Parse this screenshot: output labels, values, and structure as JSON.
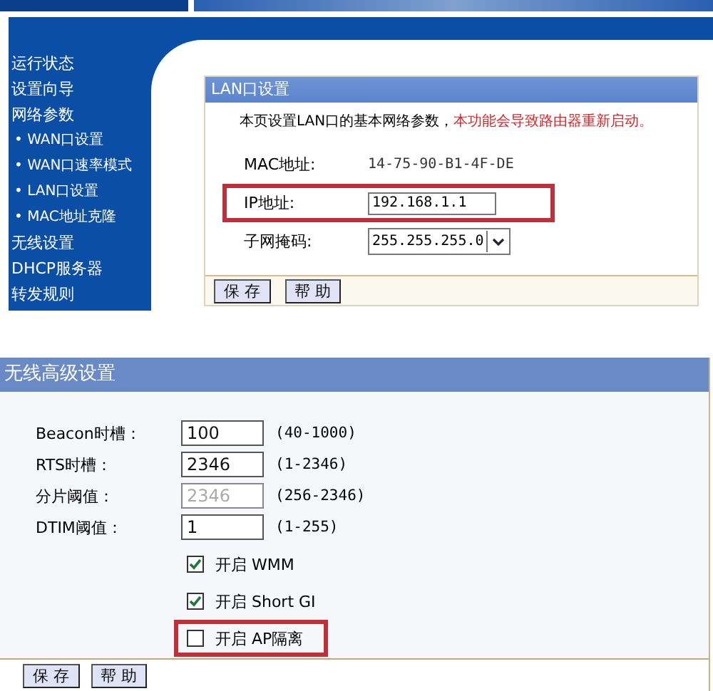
{
  "sidebar": {
    "items": [
      {
        "label": "运行状态"
      },
      {
        "label": "设置向导"
      },
      {
        "label": "网络参数",
        "children": [
          {
            "label": "• WAN口设置"
          },
          {
            "label": "• WAN口速率模式"
          },
          {
            "label": "• LAN口设置"
          },
          {
            "label": "• MAC地址克隆"
          }
        ]
      },
      {
        "label": "无线设置"
      },
      {
        "label": "DHCP服务器"
      },
      {
        "label": "转发规则"
      }
    ]
  },
  "lan_panel": {
    "title": "LAN口设置",
    "description": "本页设置LAN口的基本网络参数，",
    "warning": "本功能会导致路由器重新启动。",
    "fields": [
      {
        "kind": "text",
        "label": "MAC地址:",
        "value": "14-75-90-B1-4F-DE",
        "highlighted": false
      },
      {
        "kind": "input",
        "label": "IP地址:",
        "value": "192.168.1.1",
        "highlighted": true
      },
      {
        "kind": "select",
        "label": "子网掩码:",
        "value": "255.255.255.0",
        "highlighted": false
      }
    ],
    "buttons": [
      "保 存",
      "帮 助"
    ]
  },
  "wireless_panel": {
    "title": "无线高级设置",
    "fields": [
      {
        "label": "Beacon时槽：",
        "value": "100",
        "range": "(40-1000)",
        "disabled": false
      },
      {
        "label": "RTS时槽：",
        "value": "2346",
        "range": "(1-2346)",
        "disabled": false
      },
      {
        "label": "分片阈值：",
        "value": "2346",
        "range": "(256-2346)",
        "disabled": true
      },
      {
        "label": "DTIM阈值：",
        "value": "1",
        "range": "(1-255)",
        "disabled": false
      }
    ],
    "checkboxes": [
      {
        "label": "开启 WMM",
        "checked": true,
        "highlighted": false
      },
      {
        "label": "开启 Short GI",
        "checked": true,
        "highlighted": false
      },
      {
        "label": "开启 AP隔离",
        "checked": false,
        "highlighted": true
      }
    ],
    "buttons": [
      "保 存",
      "帮 助"
    ]
  }
}
